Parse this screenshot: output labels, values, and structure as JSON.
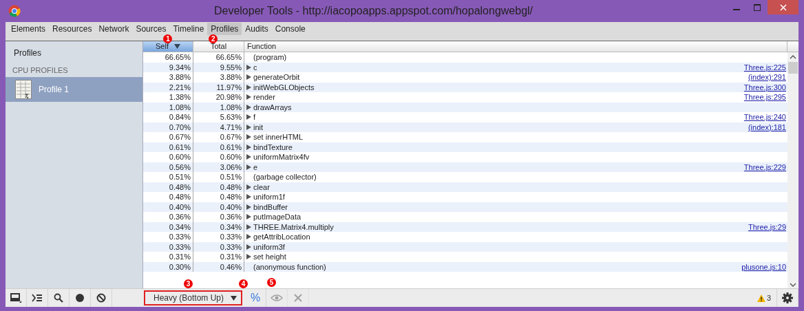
{
  "window": {
    "title": "Developer Tools - http://iacopoapps.appspot.com/hopalongwebgl/"
  },
  "tabs": [
    {
      "label": "Elements",
      "selected": false
    },
    {
      "label": "Resources",
      "selected": false
    },
    {
      "label": "Network",
      "selected": false
    },
    {
      "label": "Sources",
      "selected": false
    },
    {
      "label": "Timeline",
      "selected": false
    },
    {
      "label": "Profiles",
      "selected": true
    },
    {
      "label": "Audits",
      "selected": false
    },
    {
      "label": "Console",
      "selected": false
    }
  ],
  "sidebar": {
    "title": "Profiles",
    "section": "CPU PROFILES",
    "items": [
      {
        "label": "Profile 1",
        "selected": true
      }
    ]
  },
  "table": {
    "columns": [
      {
        "label": "Self",
        "sorted": true
      },
      {
        "label": "Total",
        "sorted": false
      },
      {
        "label": "Function",
        "sorted": false
      }
    ],
    "rows": [
      {
        "self": "66.65%",
        "total": "66.65%",
        "function": "(program)",
        "expandable": false
      },
      {
        "self": "9.34%",
        "total": "9.55%",
        "function": "c",
        "expandable": true,
        "link": "Three.js:225"
      },
      {
        "self": "3.88%",
        "total": "3.88%",
        "function": "generateOrbit",
        "expandable": true,
        "link": "(index):291"
      },
      {
        "self": "2.21%",
        "total": "11.97%",
        "function": "initWebGLObjects",
        "expandable": true,
        "link": "Three.js:300"
      },
      {
        "self": "1.38%",
        "total": "20.98%",
        "function": "render",
        "expandable": true,
        "link": "Three.js:295"
      },
      {
        "self": "1.08%",
        "total": "1.08%",
        "function": "drawArrays",
        "expandable": true
      },
      {
        "self": "0.84%",
        "total": "5.63%",
        "function": "f",
        "expandable": true,
        "link": "Three.js:240"
      },
      {
        "self": "0.70%",
        "total": "4.71%",
        "function": "init",
        "expandable": true,
        "link": "(index):181"
      },
      {
        "self": "0.67%",
        "total": "0.67%",
        "function": "set innerHTML",
        "expandable": true
      },
      {
        "self": "0.61%",
        "total": "0.61%",
        "function": "bindTexture",
        "expandable": true
      },
      {
        "self": "0.60%",
        "total": "0.60%",
        "function": "uniformMatrix4fv",
        "expandable": true
      },
      {
        "self": "0.56%",
        "total": "3.06%",
        "function": "e",
        "expandable": true,
        "link": "Three.js:229"
      },
      {
        "self": "0.51%",
        "total": "0.51%",
        "function": "(garbage collector)",
        "expandable": false
      },
      {
        "self": "0.48%",
        "total": "0.48%",
        "function": "clear",
        "expandable": true
      },
      {
        "self": "0.48%",
        "total": "0.48%",
        "function": "uniform1f",
        "expandable": true
      },
      {
        "self": "0.40%",
        "total": "0.40%",
        "function": "bindBuffer",
        "expandable": true
      },
      {
        "self": "0.36%",
        "total": "0.36%",
        "function": "putImageData",
        "expandable": true
      },
      {
        "self": "0.34%",
        "total": "0.34%",
        "function": "THREE.Matrix4.multiply",
        "expandable": true,
        "link": "Three.js:29"
      },
      {
        "self": "0.33%",
        "total": "0.33%",
        "function": "getAttribLocation",
        "expandable": true
      },
      {
        "self": "0.33%",
        "total": "0.33%",
        "function": "uniform3f",
        "expandable": true
      },
      {
        "self": "0.31%",
        "total": "0.31%",
        "function": "set height",
        "expandable": true
      },
      {
        "self": "0.30%",
        "total": "0.46%",
        "function": "(anonymous function)",
        "expandable": false,
        "link": "plusone.js:10"
      }
    ]
  },
  "status_bar": {
    "view_mode": "Heavy (Bottom Up)",
    "view_mode_highlighted": true,
    "percent": {
      "label": "%",
      "selected": true
    },
    "focus_disabled": true,
    "exclude_disabled": true,
    "warnings": "3"
  },
  "annotations": [
    "1",
    "2",
    "3",
    "4",
    "5"
  ]
}
